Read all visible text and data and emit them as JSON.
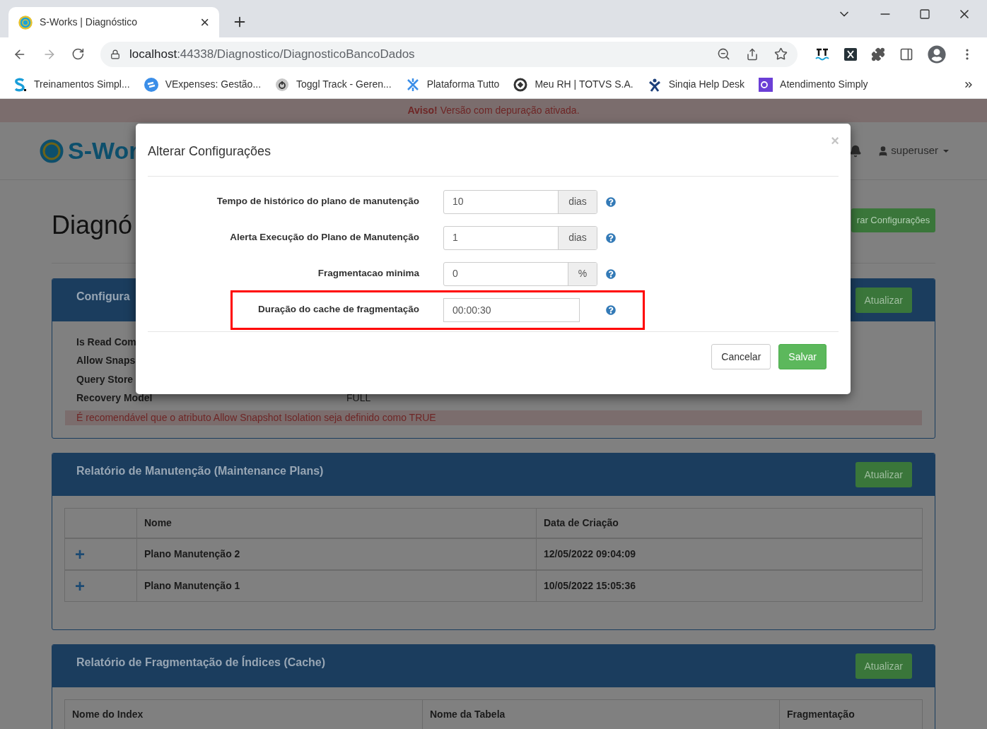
{
  "browser": {
    "tab": {
      "title": "S-Works | Diagnóstico",
      "close": "×"
    },
    "url": {
      "host": "localhost",
      "path": ":44338/Diagnostico/DiagnosticoBancoDados"
    },
    "bookmarks": [
      {
        "label": "Treinamentos Simpl...",
        "kind": "s"
      },
      {
        "label": "VExpenses: Gestão...",
        "kind": "sync"
      },
      {
        "label": "Toggl Track - Geren...",
        "kind": "power"
      },
      {
        "label": "Plataforma Tutto",
        "kind": "cross"
      },
      {
        "label": "Meu RH | TOTVS S.A.",
        "kind": "ring"
      },
      {
        "label": "Sinqia Help Desk",
        "kind": "figure"
      },
      {
        "label": "Atendimento Simply",
        "kind": "square"
      }
    ]
  },
  "page": {
    "warning": {
      "strong": "Aviso!",
      "text": "Versão com depuração ativada."
    },
    "brand": "S-Wor",
    "user": "superuser",
    "title": "Diagnó",
    "header_button": "rar Configurações",
    "panels": [
      {
        "kind": "properties",
        "title": "Configura",
        "button": "Atualizar",
        "rows": [
          {
            "label": "Is Read Com"
          },
          {
            "label": "Allow Snaps"
          },
          {
            "label": "Query Store"
          },
          {
            "label": "Recovery Model",
            "value": "FULL"
          }
        ],
        "alert": "É recomendável que o atributo Allow Snapshot Isolation seja definido como TRUE"
      },
      {
        "kind": "table",
        "title": "Relatório de Manutenção (Maintenance Plans)",
        "button": "Atualizar",
        "columns": [
          "",
          "Nome",
          "Data de Criação"
        ],
        "rows": [
          {
            "cells": [
              "+",
              "Plano Manutenção 2",
              "12/05/2022 09:04:09"
            ]
          },
          {
            "cells": [
              "+",
              "Plano Manutenção 1",
              "10/05/2022 15:05:36"
            ]
          }
        ]
      },
      {
        "kind": "table",
        "title": "Relatório de Fragmentação de Índices (Cache)",
        "button": "Atualizar",
        "columns": [
          "Nome do Index",
          "Nome da Tabela",
          "Fragmentação"
        ]
      }
    ]
  },
  "modal": {
    "title": "Alterar Configurações",
    "close": "×",
    "fields": [
      {
        "label": "Tempo de histórico do plano de manutenção",
        "value": "10",
        "addon": "dias",
        "highlighted": false
      },
      {
        "label": "Alerta Execução do Plano de Manutenção",
        "value": "1",
        "addon": "dias",
        "highlighted": false
      },
      {
        "label": "Fragmentacao minima",
        "value": "0",
        "addon": "%",
        "highlighted": false
      },
      {
        "label": "Duração do cache de fragmentação",
        "value": "00:00:30",
        "highlighted": true
      }
    ],
    "buttons": [
      {
        "label": "Cancelar",
        "kind": "default"
      },
      {
        "label": "Salvar",
        "kind": "primary"
      }
    ]
  }
}
